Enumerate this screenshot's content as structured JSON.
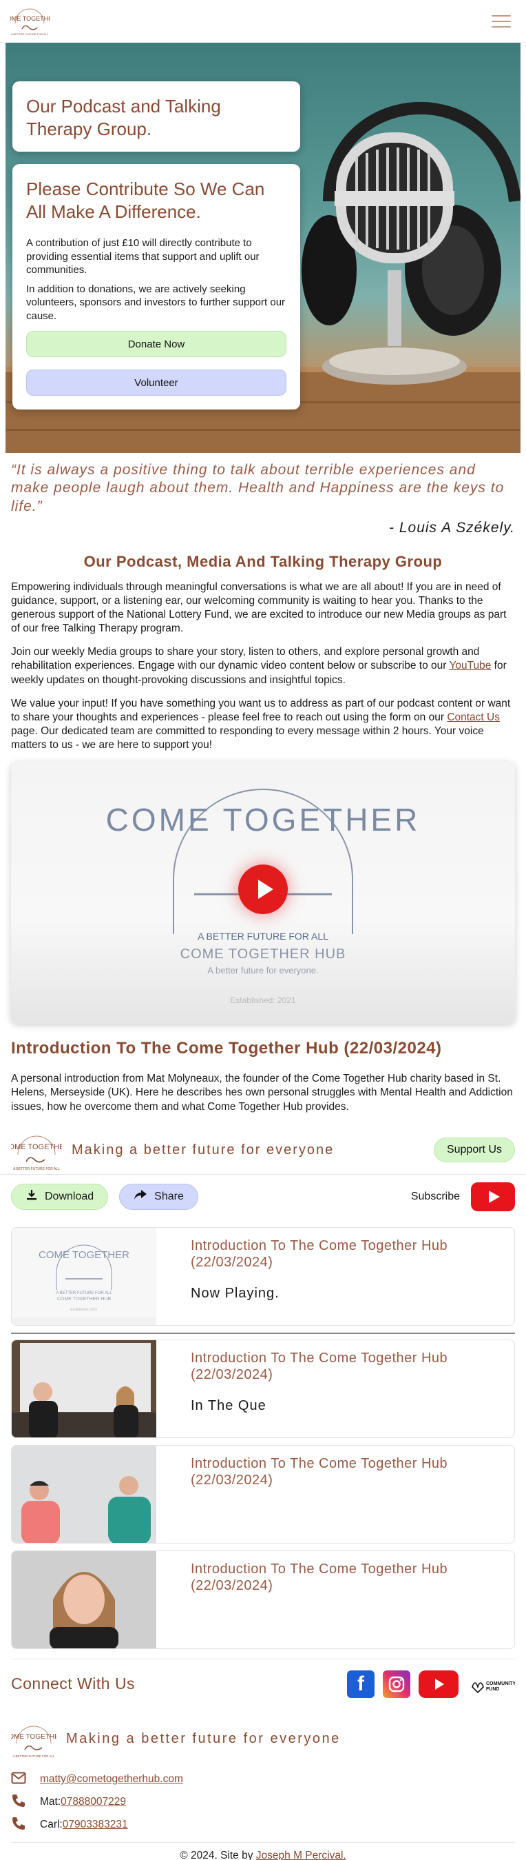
{
  "header": {
    "menu_icon": "hamburger-icon"
  },
  "hero": {
    "title": "Our Podcast and Talking Therapy Group.",
    "contribute_title": "Please Contribute So We Can All Make A Difference.",
    "para1": "A contribution of just £10 will directly contribute to providing essential items that support and uplift our communities.",
    "para2": "In addition to donations, we are actively seeking volunteers, sponsors and investors to further support our cause.",
    "donate_label": "Donate Now",
    "volunteer_label": "Volunteer"
  },
  "quote": {
    "text": "“It is always a positive thing to talk about terrible experiences and make people laugh about them. Health and Happiness are the keys to life.”",
    "author": "- Louis A Székely."
  },
  "intro": {
    "title": "Our Podcast, Media And Talking Therapy Group",
    "p1": "Empowering individuals through meaningful conversations is what we are all about! If you are in need of guidance, support, or a listening ear, our welcoming community is waiting to hear you. Thanks to the generous support of the National Lottery Fund, we are excited to introduce our new Media groups as part of our free Talking Therapy program.",
    "p2_before": "Join our weekly Media groups to share your story, listen to others, and explore personal growth and rehabilitation experiences. Engage with our dynamic video content below or subscribe to our ",
    "p2_link": "YouTube",
    "p2_after": " for weekly updates on thought-provoking discussions and insightful topics.",
    "p3_before": "We value your input! If you have something you want us to address as part of our podcast content or want to share your thoughts and experiences - please feel free to reach out using the form on our ",
    "p3_link": "Contact Us",
    "p3_after": " page. Our dedicated team are committed to responding to every message within 2 hours. Your voice matters to us - we are here to support you!"
  },
  "video": {
    "logo_text": "COME TOGETHER",
    "logo_tagline": "A BETTER FUTURE FOR ALL",
    "hub_name": "COME TOGETHER HUB",
    "hub_tagline": "A better future for everyone.",
    "established": "Established: 2021",
    "title": "Introduction To The Come Together Hub (22/03/2024)",
    "description": "A personal introduction from Mat Molyneaux, the founder of the Come Together Hub charity based in St. Helens, Merseyside (UK). Here he describes hes own personal struggles with Mental Health and Addiction issues, how he overcome them and what Come Together Hub provides."
  },
  "channel": {
    "tagline": "Making a better future for everyone",
    "subscribe_label": "Subscribe",
    "subscribe_short": "Subscribe",
    "download_label": "Download",
    "share_label": "Share",
    "support_label": "Support Us"
  },
  "playlist": [
    {
      "title": "Introduction To The Come Together Hub (22/03/2024)",
      "status": "Now Playing."
    },
    {
      "title": "Introduction To The Come Together Hub (22/03/2024)",
      "status": "In The Que"
    },
    {
      "title": "Introduction To The Come Together Hub (22/03/2024)",
      "status": ""
    },
    {
      "title": "Introduction To The Come Together Hub (22/03/2024)",
      "status": ""
    }
  ],
  "connect": {
    "title": "Connect With Us",
    "icons": [
      "facebook-icon",
      "instagram-icon",
      "youtube-icon",
      "community-fund-logo"
    ],
    "community_fund": "COMMUNITY FUND"
  },
  "footer": {
    "tagline": "Making a better future for everyone",
    "email": "matty@cometogetherhub.com",
    "mat_label": "Mat: ",
    "mat_phone": "07888007229",
    "carl_label": "Carl: ",
    "carl_phone": "07903383231",
    "copyright": "© 2024. Site by ",
    "site_by": "Joseph M Percival."
  },
  "colors": {
    "brand": "#8a4a32",
    "green_btn": "#d6f6c9",
    "blue_btn": "#d1d8fb",
    "youtube": "#e8141c"
  }
}
